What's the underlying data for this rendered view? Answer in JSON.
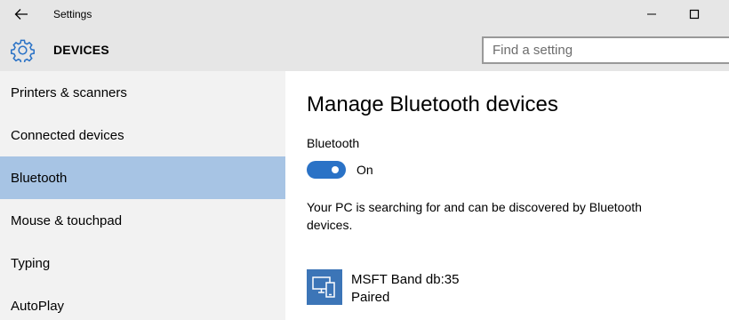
{
  "window": {
    "title": "Settings"
  },
  "header": {
    "section_title": "DEVICES",
    "search_placeholder": "Find a setting"
  },
  "sidebar": {
    "items": [
      {
        "label": "Printers & scanners"
      },
      {
        "label": "Connected devices"
      },
      {
        "label": "Bluetooth",
        "active": true
      },
      {
        "label": "Mouse & touchpad"
      },
      {
        "label": "Typing"
      },
      {
        "label": "AutoPlay"
      }
    ]
  },
  "main": {
    "heading": "Manage Bluetooth devices",
    "bluetooth_label": "Bluetooth",
    "toggle_state": "On",
    "toggle_on": true,
    "description": "Your PC is searching for and can be discovered by Bluetooth devices.",
    "devices": [
      {
        "name": "MSFT Band db:35",
        "status": "Paired",
        "icon": "device-pc-phone-icon"
      }
    ]
  },
  "colors": {
    "accent": "#2a72c6",
    "sidebar_active": "#a7c4e4",
    "header_bg": "#e6e6e6",
    "sidebar_bg": "#f2f2f2",
    "device_tile": "#3c75b7"
  }
}
